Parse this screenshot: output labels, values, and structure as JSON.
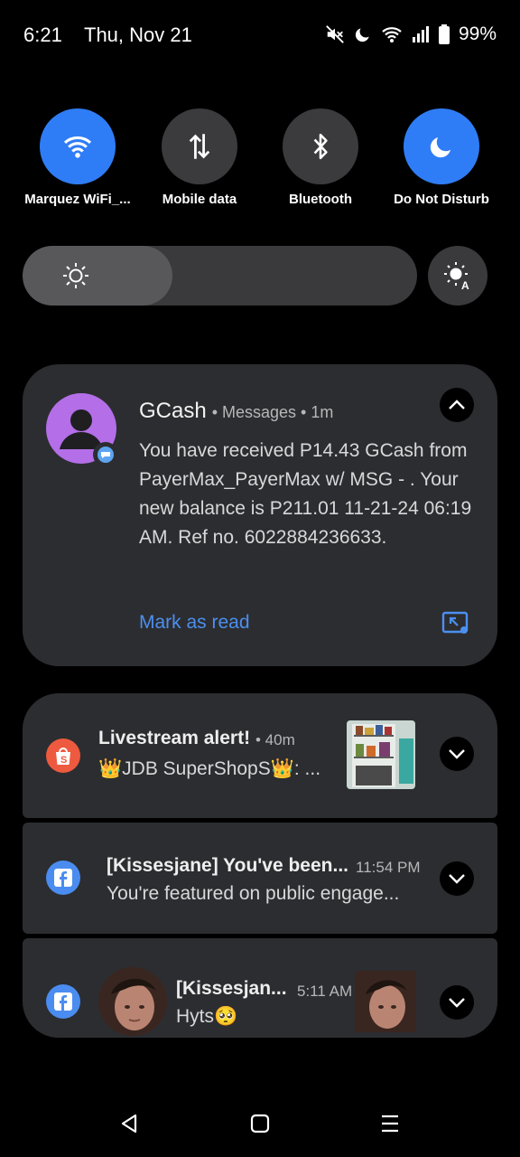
{
  "status": {
    "time": "6:21",
    "date": "Thu, Nov 21",
    "battery": "99%"
  },
  "quick_settings": [
    {
      "label": "Marquez WiFi_...",
      "icon": "wifi-icon",
      "state": "on"
    },
    {
      "label": "Mobile data",
      "icon": "mobile-data-icon",
      "state": "off"
    },
    {
      "label": "Bluetooth",
      "icon": "bluetooth-icon",
      "state": "off"
    },
    {
      "label": "Do Not Disturb",
      "icon": "moon-icon",
      "state": "on"
    }
  ],
  "brightness": {
    "level": 0.38,
    "icon": "sun-icon",
    "auto_icon": "auto-brightness-icon"
  },
  "gcash": {
    "app": "GCash",
    "meta": "• Messages • 1m",
    "body": "You have received P14.43 GCash from PayerMax_PayerMax w/ MSG - . Your new balance is P211.01 11-21-24 06:19 AM. Ref no. 6022884236633.",
    "action": "Mark as read",
    "colors": {
      "accent": "#4c8fef",
      "avatar": "#b46ee8"
    }
  },
  "notifications": [
    {
      "app_icon": "shopee-icon",
      "title": "Livestream alert!",
      "meta": "• 40m",
      "text": "👑JDB SuperShopS👑: ...",
      "color": "#ee5a3f"
    },
    {
      "app_icon": "facebook-icon",
      "title": "[Kissesjane] You've been...",
      "meta": "11:54 PM",
      "text": "You're featured on public engage...",
      "color": "#4b8cf0"
    },
    {
      "app_icon": "facebook-icon",
      "title": "[Kissesjan...",
      "meta": "5:11 AM",
      "text": "Hyts🥺",
      "color": "#4b8cf0"
    }
  ],
  "nav": {
    "back": "back-icon",
    "home": "home-icon",
    "recents": "recents-icon"
  }
}
